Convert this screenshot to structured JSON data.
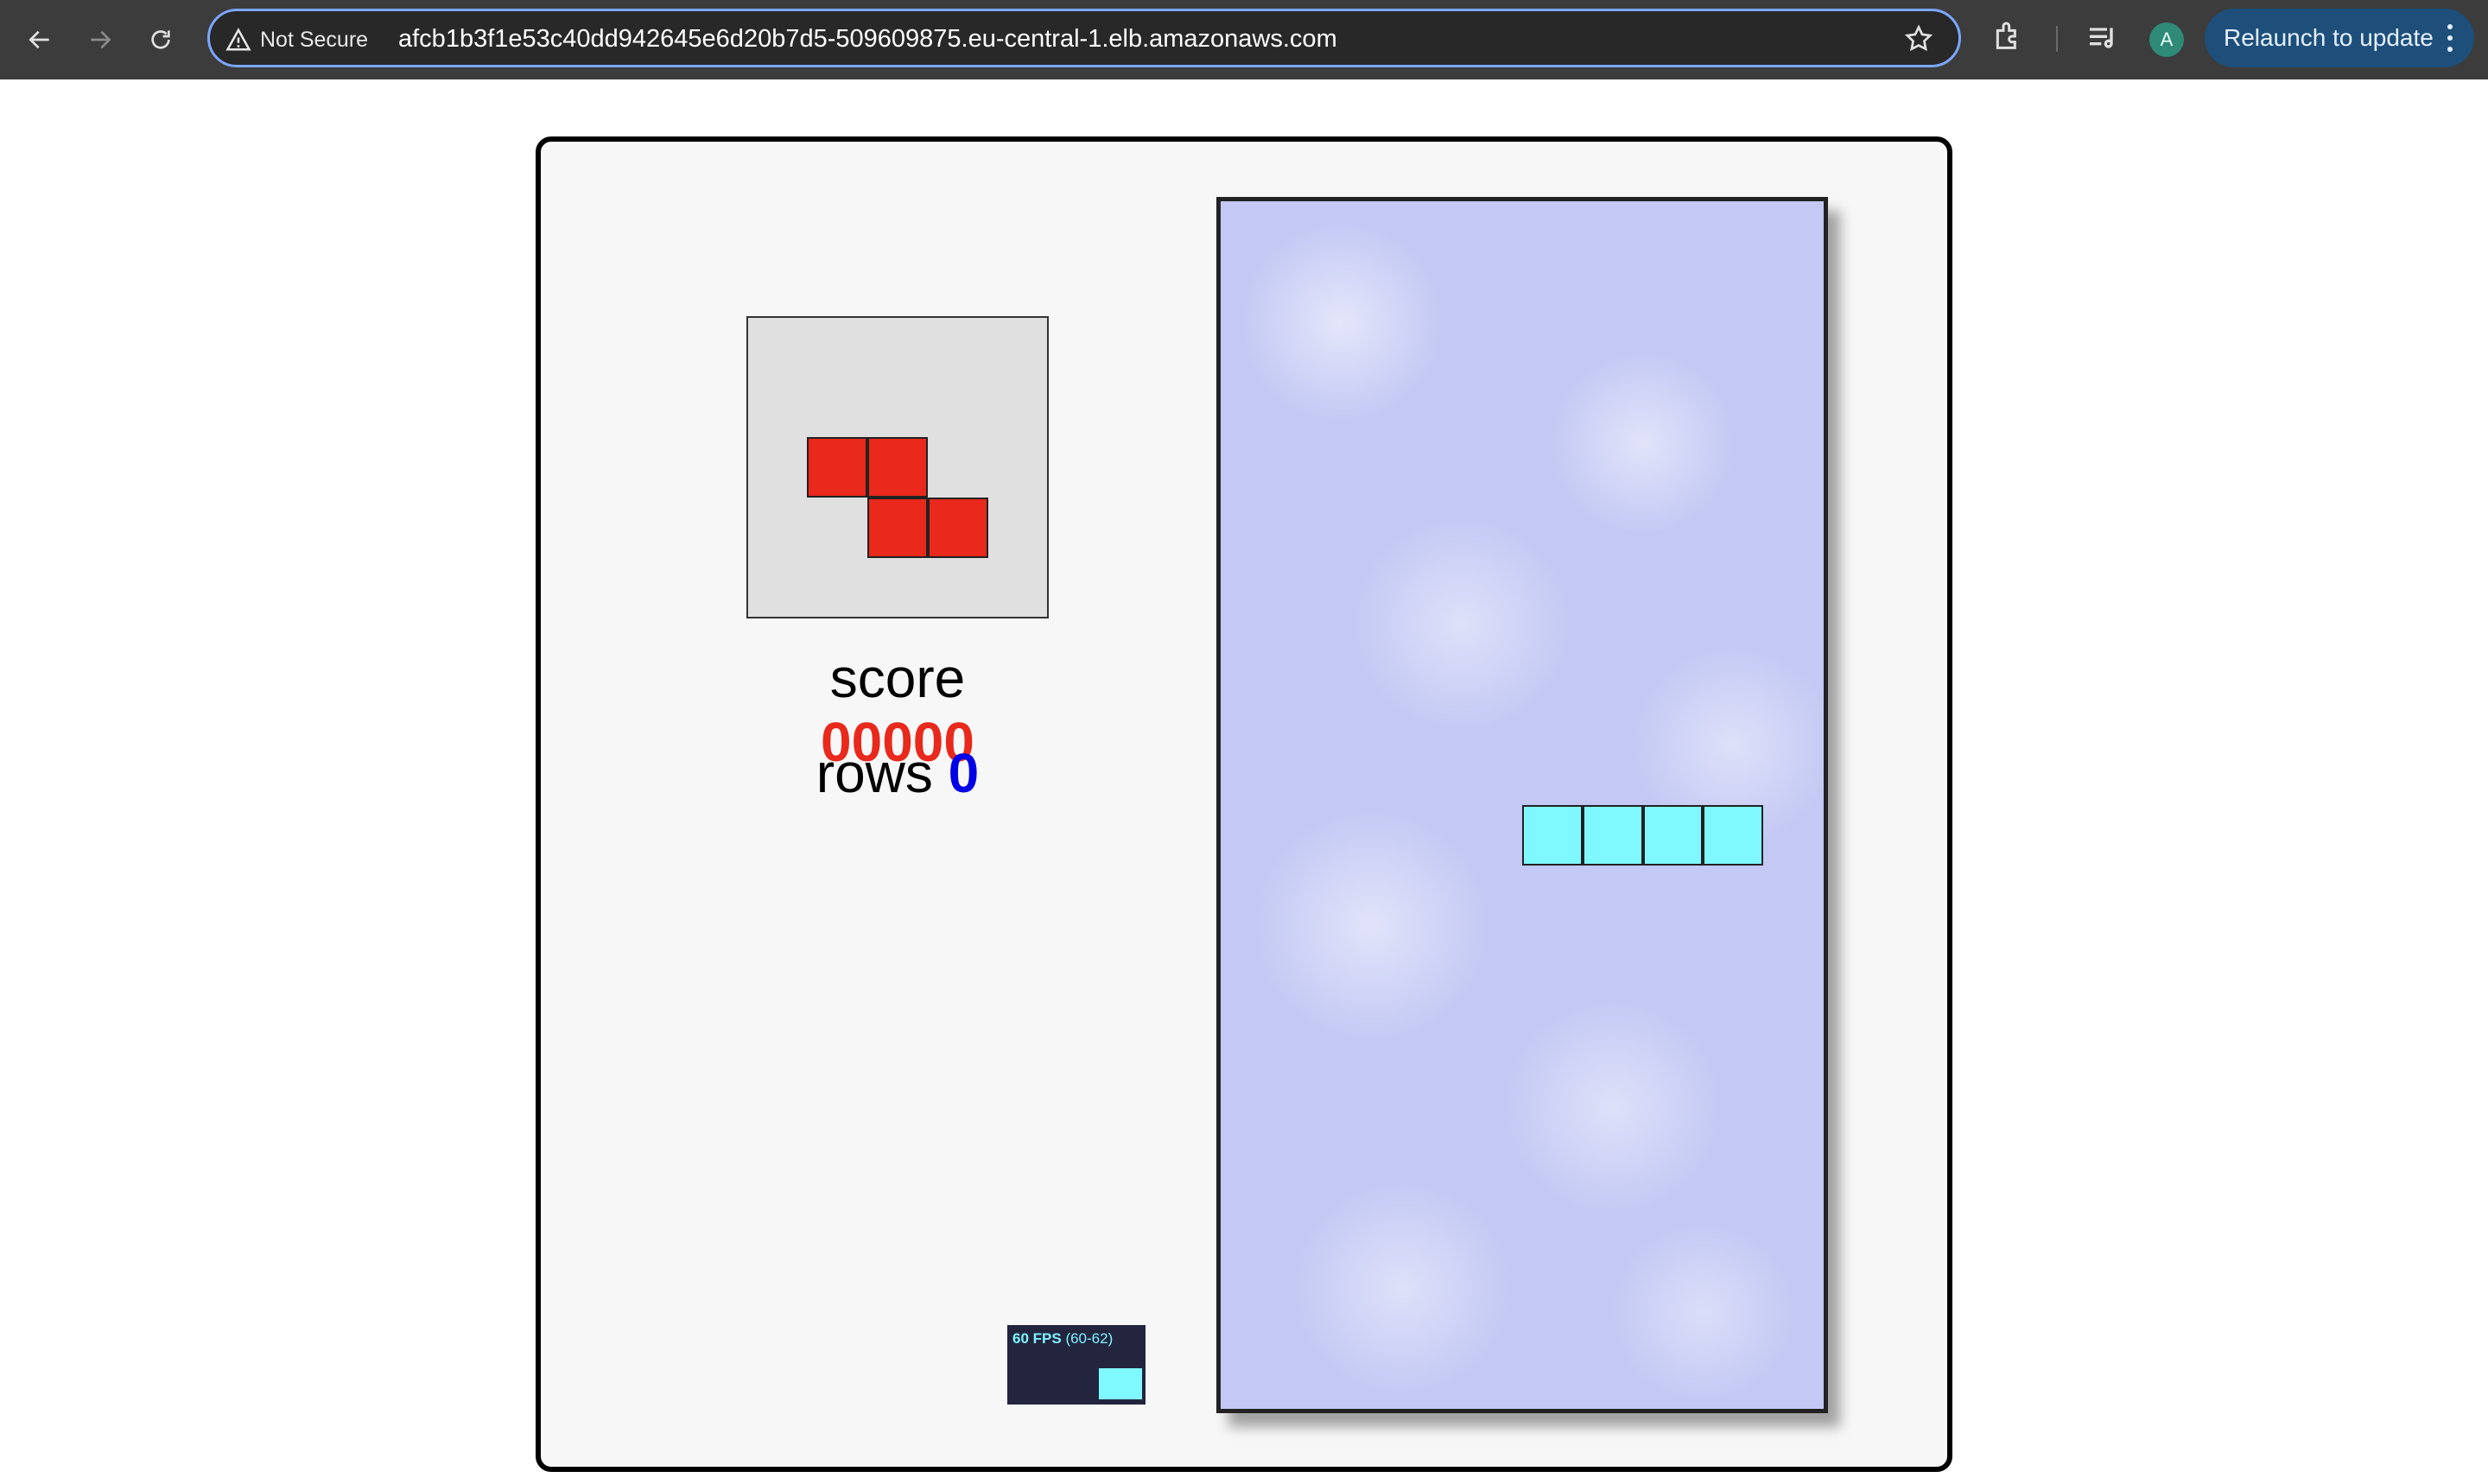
{
  "browser": {
    "security_label": "Not Secure",
    "url": "afcb1b3f1e53c40dd942645e6d20b7d5-509609875.eu-central-1.elb.amazonaws.com",
    "avatar_initial": "A",
    "relaunch_label": "Relaunch to update",
    "icons": [
      "back-arrow-icon",
      "forward-arrow-icon",
      "reload-icon",
      "warning-icon",
      "star-icon",
      "extensions-icon",
      "media-controls-icon",
      "more-vert-icon"
    ]
  },
  "game": {
    "score_label": "score",
    "score_value": "00000",
    "rows_label": "rows",
    "rows_value": "0",
    "next_piece": {
      "type": "Z",
      "color": "#e8291c",
      "cells": [
        [
          0,
          0
        ],
        [
          1,
          0
        ],
        [
          1,
          1
        ],
        [
          2,
          1
        ]
      ]
    },
    "active_piece": {
      "type": "I",
      "color": "#7ff9ff",
      "cells": [
        [
          5,
          10
        ],
        [
          6,
          10
        ],
        [
          7,
          10
        ],
        [
          8,
          10
        ]
      ]
    },
    "board_cols": 10,
    "board_rows": 20,
    "fps": {
      "label": "60 FPS",
      "range": "(60-62)"
    }
  }
}
